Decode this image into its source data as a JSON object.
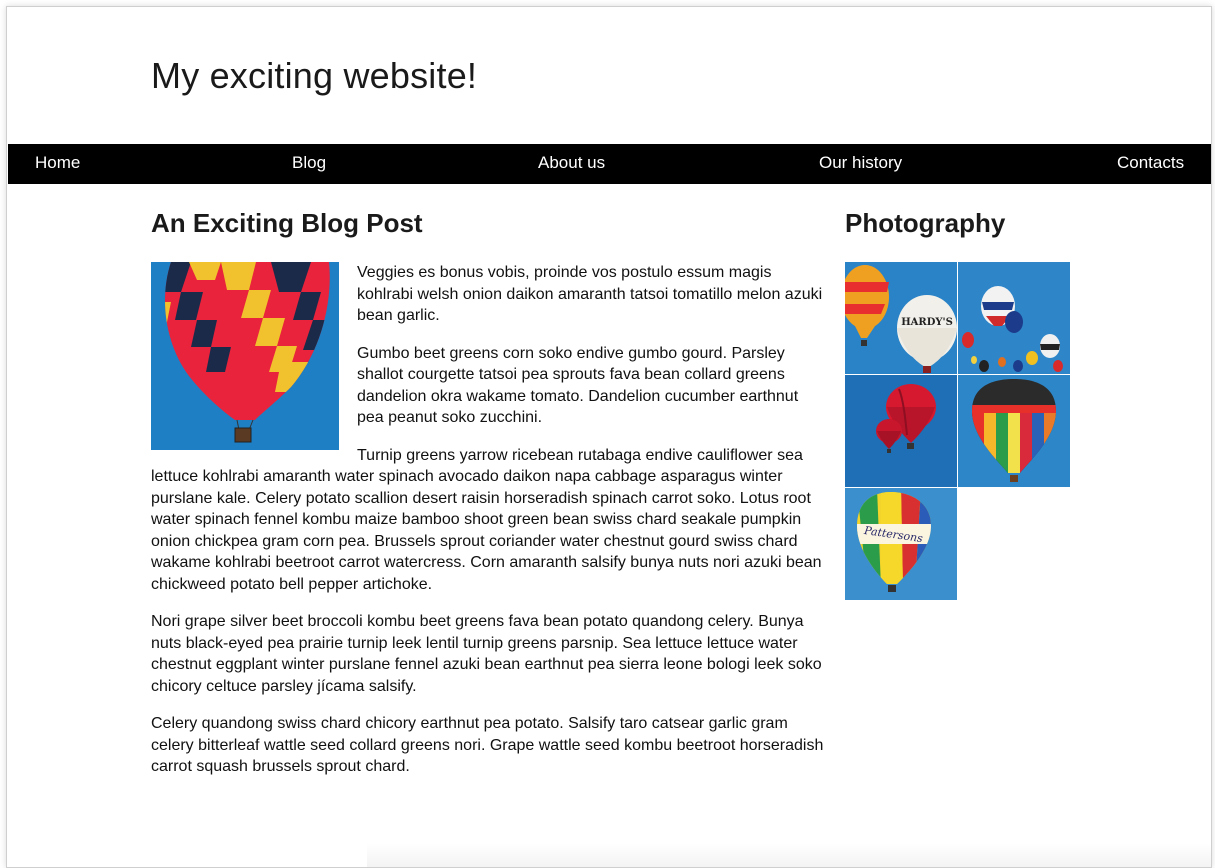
{
  "site": {
    "title": "My exciting website!"
  },
  "nav": {
    "items": [
      {
        "label": "Home"
      },
      {
        "label": "Blog"
      },
      {
        "label": "About us"
      },
      {
        "label": "Our history"
      },
      {
        "label": "Contacts"
      }
    ]
  },
  "post": {
    "heading": "An Exciting Blog Post",
    "feature_image": "hot-air-balloon-photo",
    "paragraphs": [
      "Veggies es bonus vobis, proinde vos postulo essum magis kohlrabi welsh onion daikon amaranth tatsoi tomatillo melon azuki bean garlic.",
      "Gumbo beet greens corn soko endive gumbo gourd. Parsley shallot courgette tatsoi pea sprouts fava bean collard greens dandelion okra wakame tomato. Dandelion cucumber earthnut pea peanut soko zucchini.",
      "Turnip greens yarrow ricebean rutabaga endive cauliflower sea lettuce kohlrabi amaranth water spinach avocado daikon napa cabbage asparagus winter purslane kale. Celery potato scallion desert raisin horseradish spinach carrot soko. Lotus root water spinach fennel kombu maize bamboo shoot green bean swiss chard seakale pumpkin onion chickpea gram corn pea. Brussels sprout coriander water chestnut gourd swiss chard wakame kohlrabi beetroot carrot watercress. Corn amaranth salsify bunya nuts nori azuki bean chickweed potato bell pepper artichoke.",
      "Nori grape silver beet broccoli kombu beet greens fava bean potato quandong celery. Bunya nuts black-eyed pea prairie turnip leek lentil turnip greens parsnip. Sea lettuce lettuce water chestnut eggplant winter purslane fennel azuki bean earthnut pea sierra leone bologi leek soko chicory celtuce parsley jícama salsify.",
      "Celery quandong swiss chard chicory earthnut pea potato. Salsify taro catsear garlic gram celery bitterleaf wattle seed collard greens nori. Grape wattle seed kombu beetroot horseradish carrot squash brussels sprout chard."
    ]
  },
  "sidebar": {
    "heading": "Photography",
    "photos": [
      {
        "name": "balloon-photo-hardys",
        "label": "HARDY'S"
      },
      {
        "name": "balloon-photo-festival"
      },
      {
        "name": "balloon-photo-red"
      },
      {
        "name": "balloon-photo-rainbow"
      },
      {
        "name": "balloon-photo-pattersons",
        "label": "Pattersons"
      }
    ]
  },
  "colors": {
    "nav_bg": "#000000",
    "nav_text": "#ffffff",
    "sky": "#2f86c8"
  }
}
